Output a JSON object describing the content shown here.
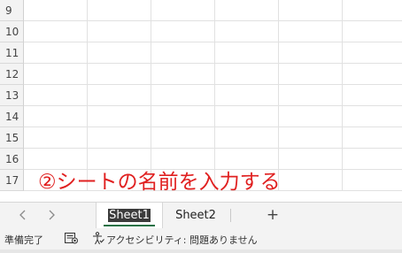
{
  "grid": {
    "rows": [
      "9",
      "10",
      "11",
      "12",
      "13",
      "14",
      "15",
      "16",
      "17"
    ]
  },
  "annotation": {
    "text": "②シートの名前を入力する",
    "color": "#e02020"
  },
  "tabbar": {
    "prev_icon": "chevron-left-icon",
    "next_icon": "chevron-right-icon",
    "tabs": [
      {
        "label": "Sheet1",
        "active": true
      },
      {
        "label": "Sheet2",
        "active": false
      }
    ],
    "add_label": "+"
  },
  "statusbar": {
    "ready": "準備完了",
    "accessibility": "アクセシビリティ: 問題ありません"
  },
  "colors": {
    "active_tab_underline": "#1e7145",
    "header_bg": "#f3f3f3",
    "gridline": "#e1e1e1"
  }
}
